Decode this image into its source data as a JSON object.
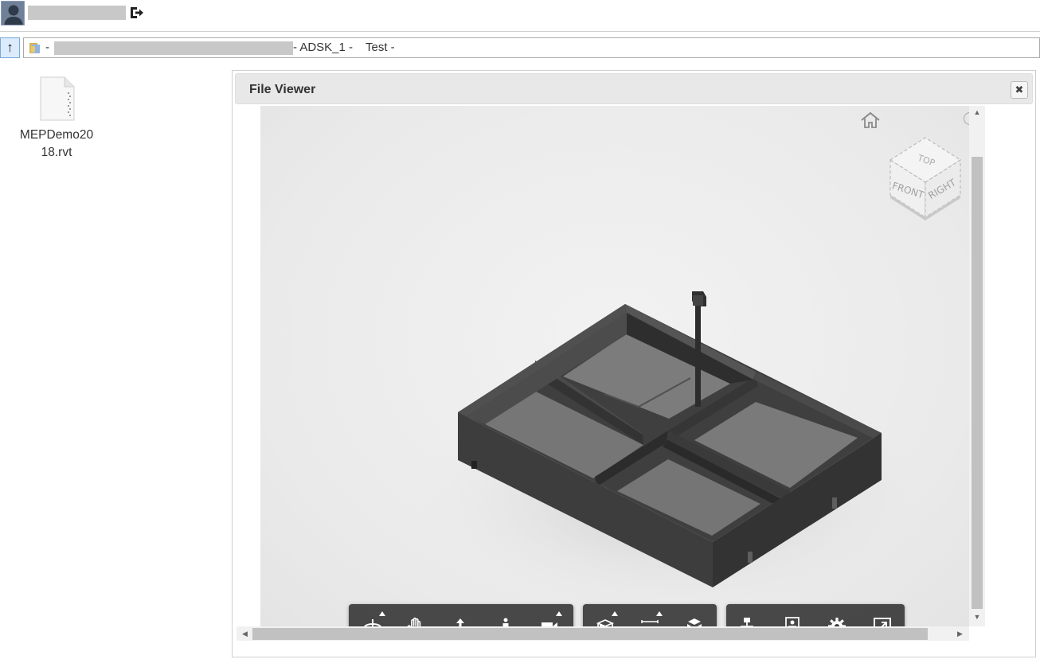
{
  "user": {
    "avatar_icon": "user-avatar-icon",
    "logout_icon": "logout-icon"
  },
  "path": {
    "separator1": "-",
    "segment_project": "-  ADSK_1 -",
    "segment_folder": "Test -"
  },
  "files": [
    {
      "name": "MEPDemo2018.rvt",
      "icon": "document-icon"
    }
  ],
  "viewer": {
    "title": "File Viewer",
    "close_glyph": "✖",
    "viewcube": {
      "top": "TOP",
      "front": "FRONT",
      "right": "RIGHT"
    },
    "toolbar_groups": [
      [
        "orbit",
        "pan",
        "zoom",
        "first-person",
        "camera"
      ],
      [
        "section",
        "measure",
        "explode"
      ],
      [
        "model-browser",
        "properties",
        "settings",
        "fullscreen"
      ]
    ]
  },
  "colors": {
    "canvas_bg": "#ececec",
    "toolbar_bg": "#3a3a3a",
    "model_wall": "#3b3b3b",
    "model_floor": "#787878"
  }
}
